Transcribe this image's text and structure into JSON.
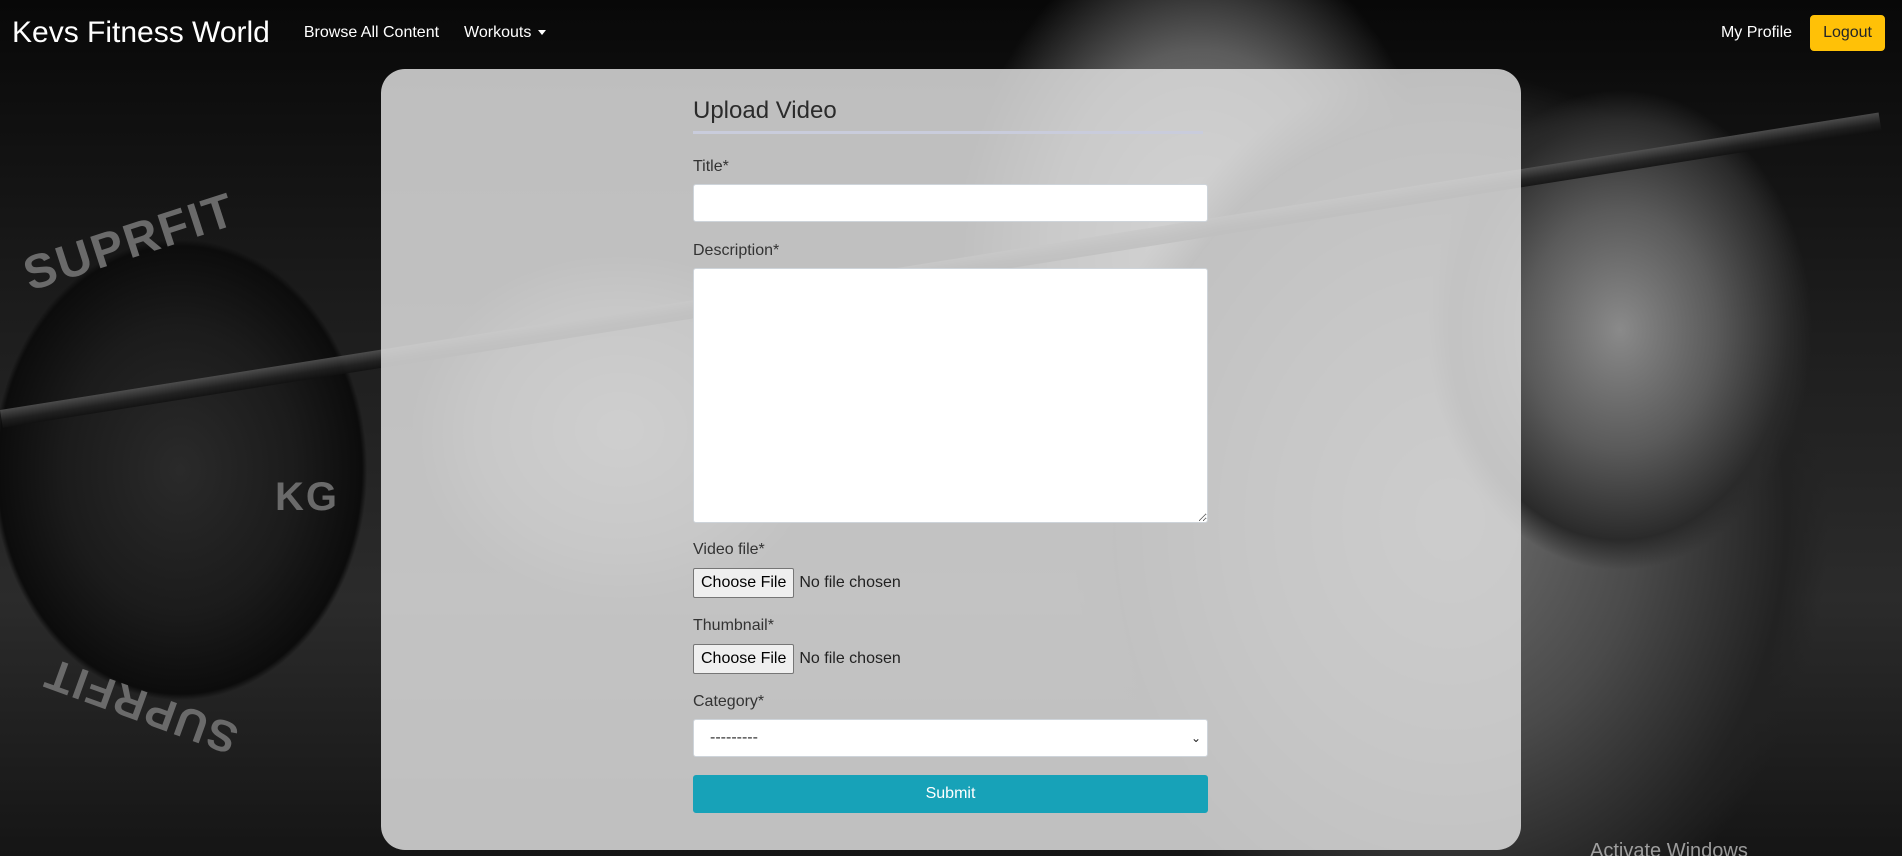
{
  "navbar": {
    "brand": "Kevs Fitness World",
    "links": {
      "browse": "Browse All Content",
      "workouts": "Workouts"
    },
    "profile": "My Profile",
    "logout": "Logout"
  },
  "form": {
    "title": "Upload Video",
    "fields": {
      "title_label": "Title*",
      "title_value": "",
      "description_label": "Description*",
      "description_value": "",
      "video_label": "Video file*",
      "video_button": "Choose File",
      "video_status": "No file chosen",
      "thumbnail_label": "Thumbnail*",
      "thumbnail_button": "Choose File",
      "thumbnail_status": "No file chosen",
      "category_label": "Category*",
      "category_selected": "---------"
    },
    "submit": "Submit"
  },
  "background": {
    "plate_text_top": "SUPRFIT",
    "plate_text_bottom": "SUPRFIT",
    "plate_kg": "KG"
  },
  "watermark": "Activate Windows",
  "colors": {
    "logout_bg": "#ffc107",
    "submit_bg": "#17a2b8",
    "card_bg": "rgba(220,220,220,0.86)"
  }
}
